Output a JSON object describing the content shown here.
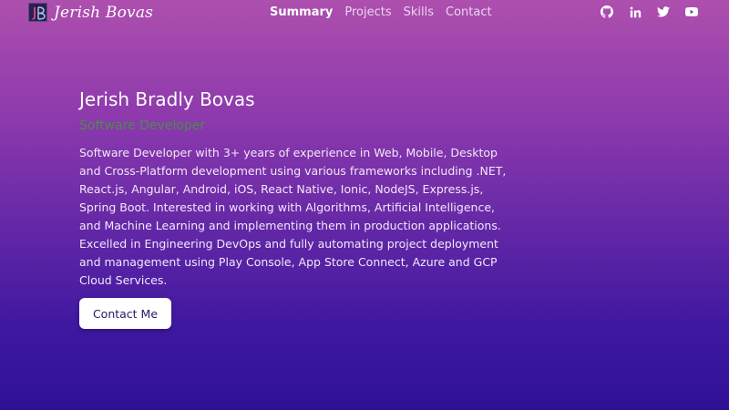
{
  "brand": {
    "name": "Jerish Bovas",
    "logo_icon": "jb-monogram-logo"
  },
  "nav": {
    "links": [
      {
        "label": "Summary",
        "active": true
      },
      {
        "label": "Projects",
        "active": false
      },
      {
        "label": "Skills",
        "active": false
      },
      {
        "label": "Contact",
        "active": false
      }
    ]
  },
  "socials": [
    {
      "icon": "github-icon"
    },
    {
      "icon": "linkedin-icon"
    },
    {
      "icon": "twitter-icon"
    },
    {
      "icon": "youtube-icon"
    }
  ],
  "hero": {
    "name": "Jerish Bradly Bovas",
    "role": "Software Developer",
    "bio": "Software Developer with 3+ years of experience in Web, Mobile, Desktop and Cross-Platform development using various frameworks including .NET, React.js, Angular, Android, iOS, React Native, Ionic, NodeJS, Express.js, Spring Boot. Interested in working with Algorithms, Artificial Intelligence, and Machine Learning and implementing them in production applications. Excelled in Engineering DevOps and fully automating project deployment and management using Play Console, App Store Connect, Azure and GCP Cloud Services.",
    "cta_label": "Contact Me"
  },
  "colors": {
    "gradient_top": "#ad4fad",
    "gradient_bottom": "#2f1196",
    "role_text": "#4d8a4d",
    "button_text": "#2a1766"
  }
}
